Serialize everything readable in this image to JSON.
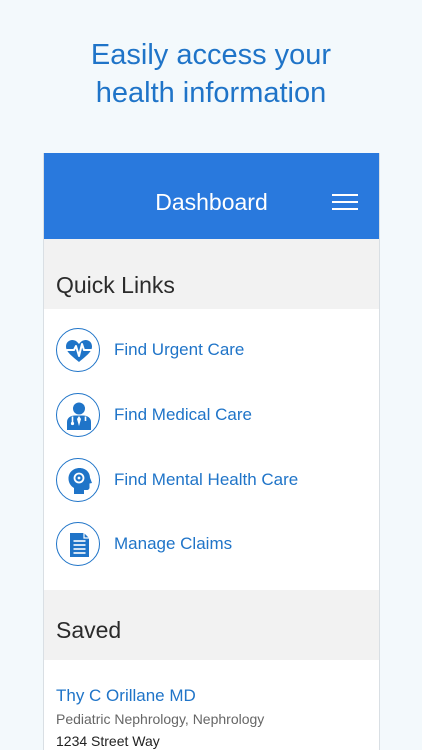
{
  "headline": {
    "line1": "Easily access your",
    "line2": "health information"
  },
  "appbar": {
    "title": "Dashboard",
    "menu_icon": "hamburger-menu-icon"
  },
  "quick_links": {
    "title": "Quick Links",
    "items": [
      {
        "label": "Find Urgent Care",
        "icon": "heart-pulse-icon"
      },
      {
        "label": "Find Medical Care",
        "icon": "doctor-icon"
      },
      {
        "label": "Find Mental Health Care",
        "icon": "head-profile-icon"
      },
      {
        "label": "Manage Claims",
        "icon": "document-icon"
      }
    ]
  },
  "saved": {
    "title": "Saved",
    "provider": {
      "name": "Thy C Orillane MD",
      "specialty": "Pediatric Nephrology, Nephrology",
      "address": "1234 Street Way"
    }
  },
  "colors": {
    "accent": "#1f74c8",
    "appbar": "#2979dd",
    "background": "#f3f9fc",
    "section": "#f2f2f2"
  }
}
